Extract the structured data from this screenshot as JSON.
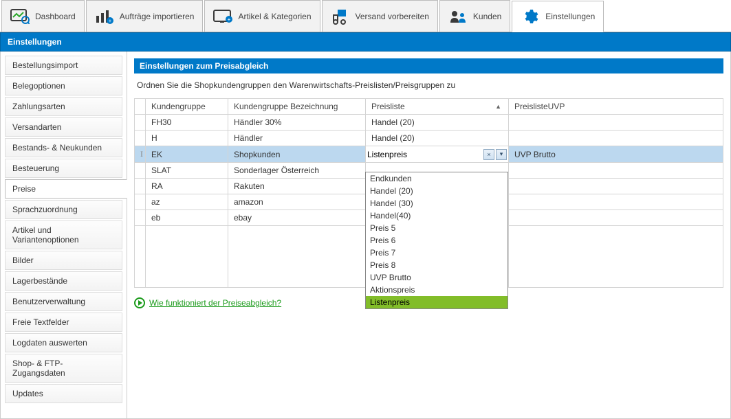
{
  "top_tabs": [
    {
      "label": "Dashboard",
      "icon": "dashboard"
    },
    {
      "label": "Aufträge importieren",
      "icon": "import"
    },
    {
      "label": "Artikel & Kategorien",
      "icon": "catalog"
    },
    {
      "label": "Versand vorbereiten",
      "icon": "shipping"
    },
    {
      "label": "Kunden",
      "icon": "customers"
    },
    {
      "label": "Einstellungen",
      "icon": "settings",
      "active": true
    }
  ],
  "banner": "Einstellungen",
  "sidebar": {
    "items": [
      "Bestellungsimport",
      "Belegoptionen",
      "Zahlungsarten",
      "Versandarten",
      "Bestands- & Neukunden",
      "Besteuerung",
      "Preise",
      "Sprachzuordnung",
      "Artikel und Variantenoptionen",
      "Bilder",
      "Lagerbestände",
      "Benutzerverwaltung",
      "Freie Textfelder",
      "Logdaten auswerten",
      "Shop- & FTP-Zugangsdaten",
      "Updates"
    ],
    "active_index": 6
  },
  "panel": {
    "title": "Einstellungen zum Preisabgleich",
    "description": "Ordnen Sie die Shopkundengruppen den Warenwirtschafts-Preislisten/Preisgruppen zu"
  },
  "table": {
    "columns": [
      "Kundengruppe",
      "Kundengruppe Bezeichnung",
      "Preisliste",
      "PreislisteUVP"
    ],
    "sort_col_index": 2,
    "rows": [
      {
        "kg": "FH30",
        "bez": "Händler 30%",
        "pl": "Handel (20)",
        "uvp": ""
      },
      {
        "kg": "H",
        "bez": "Händler",
        "pl": "Handel (20)",
        "uvp": ""
      },
      {
        "kg": "EK",
        "bez": "Shopkunden",
        "pl": "Listenpreis",
        "uvp": "UVP Brutto",
        "selected": true,
        "editing": true
      },
      {
        "kg": "SLAT",
        "bez": "Sonderlager Österreich",
        "pl": "",
        "uvp": ""
      },
      {
        "kg": "RA",
        "bez": "Rakuten",
        "pl": "",
        "uvp": ""
      },
      {
        "kg": "az",
        "bez": "amazon",
        "pl": "",
        "uvp": ""
      },
      {
        "kg": "eb",
        "bez": "ebay",
        "pl": "",
        "uvp": ""
      }
    ]
  },
  "dropdown": {
    "options": [
      "Endkunden",
      "Handel (20)",
      "Handel (30)",
      "Handel(40)",
      "Preis 5",
      "Preis 6",
      "Preis 7",
      "Preis 8",
      "UVP Brutto",
      "Aktionspreis",
      "Listenpreis"
    ],
    "highlight_index": 10
  },
  "help_link": "Wie funktioniert der Preiseabgleich?",
  "combo_buttons": {
    "clear": "×",
    "open": "▾"
  }
}
